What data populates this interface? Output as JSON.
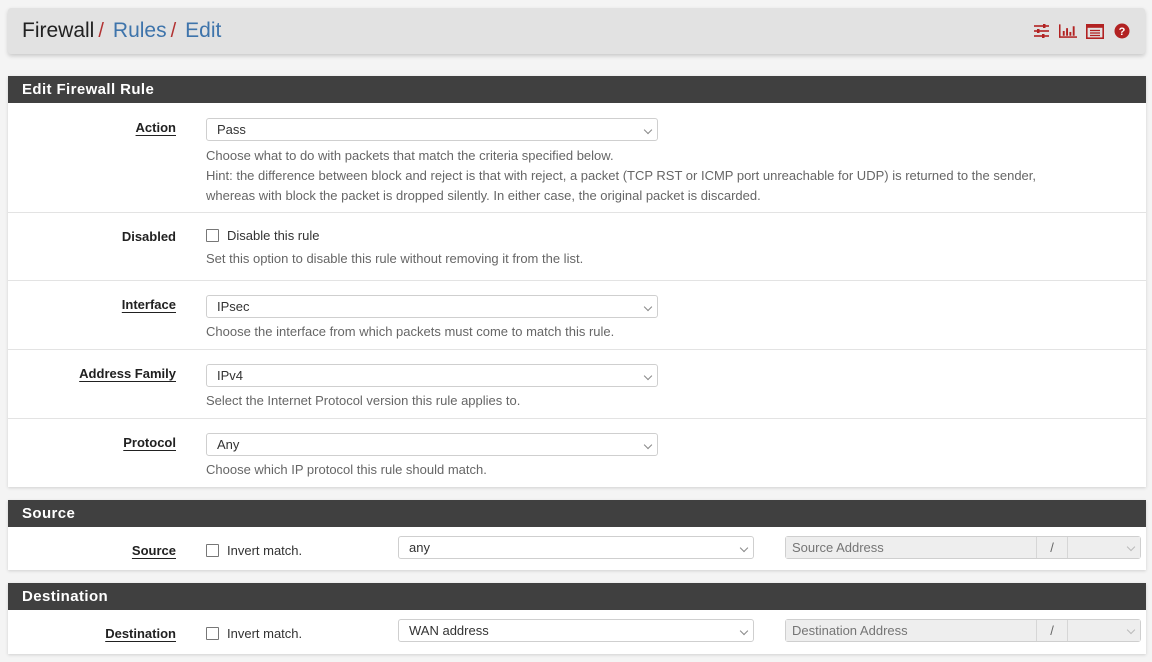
{
  "header": {
    "breadcrumb": [
      {
        "label": "Firewall",
        "separator": "/"
      },
      {
        "label": "Rules",
        "separator": "/"
      },
      {
        "label": "Edit"
      }
    ],
    "icons": [
      "sliders-icon",
      "bar-chart-icon",
      "list-table-icon",
      "help-circle-icon"
    ],
    "icon_color": "#b22222"
  },
  "edit_rule": {
    "title": "Edit Firewall Rule",
    "action": {
      "label": "Action",
      "value": "Pass",
      "help_line1": "Choose what to do with packets that match the criteria specified below.",
      "help_line2": "Hint: the difference between block and reject is that with reject, a packet (TCP RST or ICMP port unreachable for UDP) is returned to the sender,",
      "help_line3": "whereas with block the packet is dropped silently. In either case, the original packet is discarded."
    },
    "disabled": {
      "label": "Disabled",
      "checkbox_label": "Disable this rule",
      "checked": false,
      "help": "Set this option to disable this rule without removing it from the list."
    },
    "interface": {
      "label": "Interface",
      "value": "IPsec",
      "help": "Choose the interface from which packets must come to match this rule."
    },
    "address_family": {
      "label": "Address Family",
      "value": "IPv4",
      "help": "Select the Internet Protocol version this rule applies to."
    },
    "protocol": {
      "label": "Protocol",
      "value": "Any",
      "help": "Choose which IP protocol this rule should match."
    }
  },
  "source": {
    "title": "Source",
    "label": "Source",
    "invert_label": "Invert match.",
    "invert_checked": false,
    "type_value": "any",
    "address_placeholder": "Source Address",
    "slash": "/",
    "mask_value": ""
  },
  "destination": {
    "title": "Destination",
    "label": "Destination",
    "invert_label": "Invert match.",
    "invert_checked": false,
    "type_value": "WAN address",
    "address_placeholder": "Destination Address",
    "slash": "/",
    "mask_value": ""
  }
}
